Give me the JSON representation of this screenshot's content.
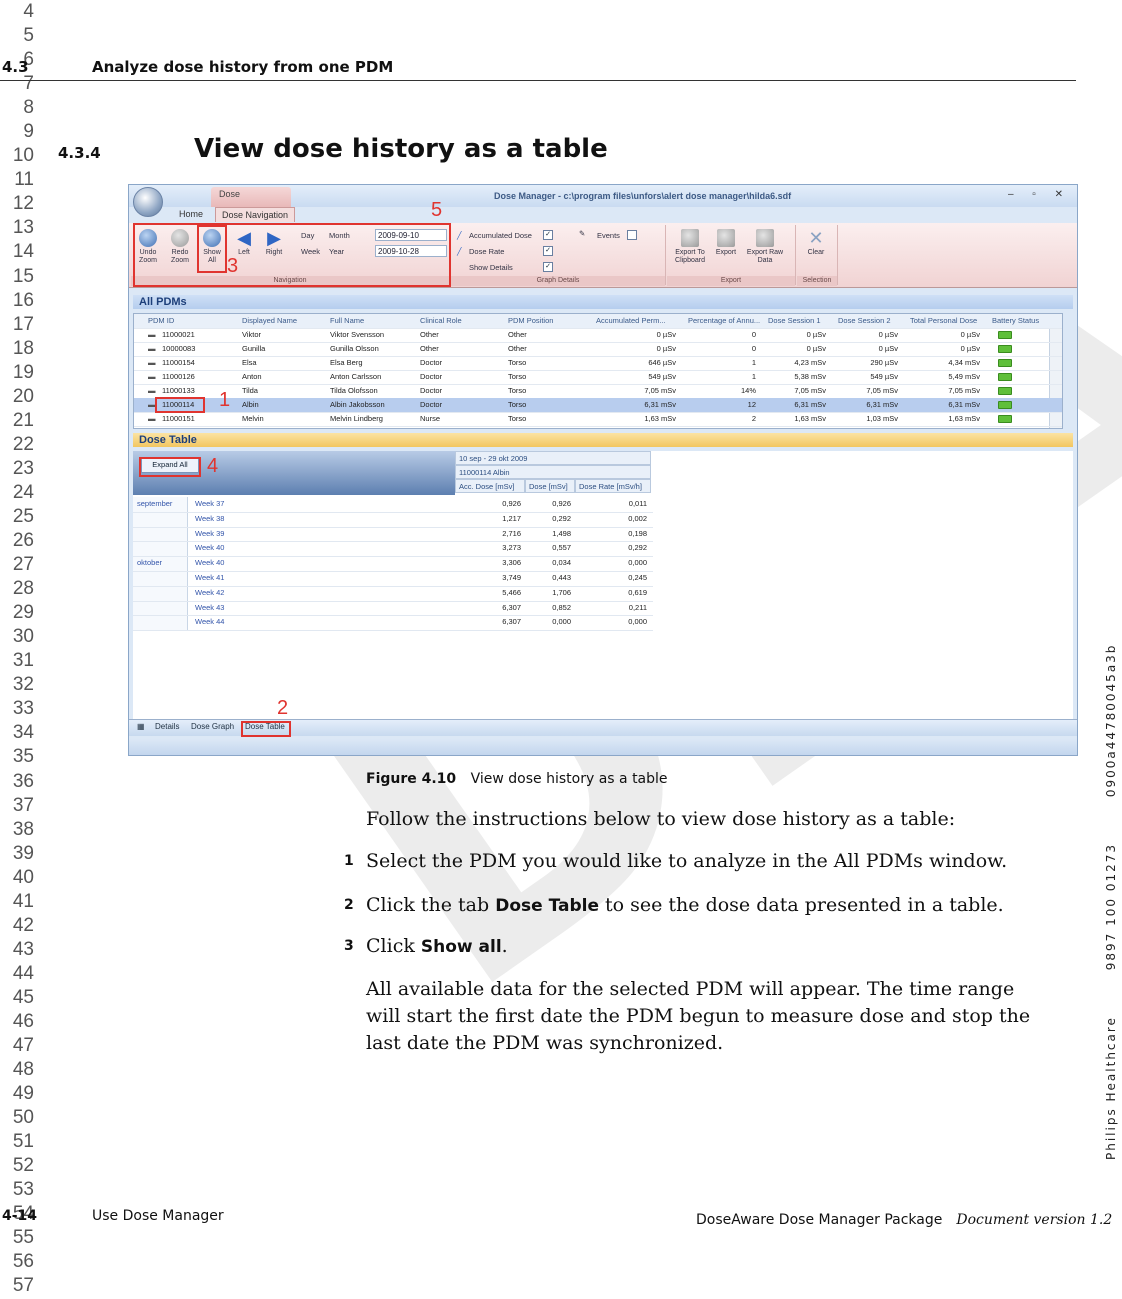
{
  "line_numbers": [
    "4",
    "5",
    "6",
    "7",
    "8",
    "9",
    "10",
    "11",
    "12",
    "13",
    "14",
    "15",
    "16",
    "17",
    "18",
    "19",
    "20",
    "21",
    "22",
    "23",
    "24",
    "25",
    "26",
    "27",
    "28",
    "29",
    "30",
    "31",
    "32",
    "33",
    "34",
    "35",
    "36",
    "37",
    "38",
    "39",
    "40",
    "41",
    "42",
    "43",
    "44",
    "45",
    "46",
    "47",
    "48",
    "49",
    "50",
    "51",
    "52",
    "53",
    "54",
    "55",
    "56",
    "57"
  ],
  "header": {
    "section": "4.3",
    "title": "Analyze dose history from one PDM"
  },
  "subsection": {
    "number": "4.3.4",
    "title": "View dose history as a table"
  },
  "watermark": "DRAFT",
  "side_text": {
    "company": "Philips Healthcare",
    "part_no": "9897 100 01273",
    "doc_id": "0900a44780045a3b"
  },
  "app": {
    "window_title": "Dose Manager - c:\\program files\\unfors\\alert dose manager\\hilda6.sdf",
    "context_tab": "Dose",
    "tabs": [
      "Home",
      "Dose Navigation"
    ],
    "ribbon": {
      "undo_zoom": "Undo Zoom",
      "redo_zoom": "Redo Zoom",
      "show_all": "Show All",
      "left": "Left",
      "right": "Right",
      "day": "Day",
      "month": "Month",
      "week": "Week",
      "year": "Year",
      "date_from": "2009-09-10",
      "date_to": "2009-10-28",
      "navigation_label": "Navigation",
      "accumulated_dose": "Accumulated Dose",
      "dose_rate": "Dose Rate",
      "show_details": "Show Details",
      "events": "Events",
      "graph_details_label": "Graph Details",
      "export_clipboard": "Export To Clipboard",
      "export": "Export",
      "export_raw": "Export Raw Data",
      "export_label": "Export",
      "clear": "Clear",
      "selection_label": "Selection"
    },
    "pdm_pane_title": "All PDMs",
    "pdm_columns": [
      "PDM ID",
      "Displayed Name",
      "Full Name",
      "Clinical Role",
      "PDM Position",
      "Accumulated Perm...",
      "Percentage of Annu...",
      "Dose Session 1",
      "Dose Session 2",
      "Total Personal Dose",
      "Battery Status"
    ],
    "pdm_rows": [
      [
        "11000021",
        "Viktor",
        "Viktor Svensson",
        "Other",
        "Other",
        "0 µSv",
        "0",
        "0 µSv",
        "0 µSv",
        "0 µSv"
      ],
      [
        "10000083",
        "Gunilla",
        "Gunilla Olsson",
        "Other",
        "Other",
        "0 µSv",
        "0",
        "0 µSv",
        "0 µSv",
        "0 µSv"
      ],
      [
        "11000154",
        "Elsa",
        "Elsa Berg",
        "Doctor",
        "Torso",
        "646 µSv",
        "1",
        "4,23 mSv",
        "290 µSv",
        "4,34 mSv"
      ],
      [
        "11000126",
        "Anton",
        "Anton Carlsson",
        "Doctor",
        "Torso",
        "549 µSv",
        "1",
        "5,38 mSv",
        "549 µSv",
        "5,49 mSv"
      ],
      [
        "11000133",
        "Tilda",
        "Tilda Olofsson",
        "Doctor",
        "Torso",
        "7,05 mSv",
        "14%",
        "7,05 mSv",
        "7,05 mSv",
        "7,05 mSv"
      ],
      [
        "11000114",
        "Albin",
        "Albin Jakobsson",
        "Doctor",
        "Torso",
        "6,31 mSv",
        "12",
        "6,31 mSv",
        "6,31 mSv",
        "6,31 mSv"
      ],
      [
        "11000151",
        "Melvin",
        "Melvin Lindberg",
        "Nurse",
        "Torso",
        "1,63 mSv",
        "2",
        "1,63 mSv",
        "1,03 mSv",
        "1,63 mSv"
      ]
    ],
    "dose_table_title": "Dose Table",
    "expand_all": "Expand All",
    "range_header": "10 sep - 29 okt 2009",
    "pdm_header": "11000114 Albin",
    "dose_columns": [
      "Acc. Dose [mSv]",
      "Dose [mSv]",
      "Dose Rate [mSv/h]"
    ],
    "dose_rows": [
      {
        "month": "september",
        "week": "Week 37",
        "acc": "0,926",
        "dose": "0,926",
        "rate": "0,011"
      },
      {
        "month": "",
        "week": "Week 38",
        "acc": "1,217",
        "dose": "0,292",
        "rate": "0,002"
      },
      {
        "month": "",
        "week": "Week 39",
        "acc": "2,716",
        "dose": "1,498",
        "rate": "0,198"
      },
      {
        "month": "",
        "week": "Week 40",
        "acc": "3,273",
        "dose": "0,557",
        "rate": "0,292"
      },
      {
        "month": "oktober",
        "week": "Week 40",
        "acc": "3,306",
        "dose": "0,034",
        "rate": "0,000"
      },
      {
        "month": "",
        "week": "Week 41",
        "acc": "3,749",
        "dose": "0,443",
        "rate": "0,245"
      },
      {
        "month": "",
        "week": "Week 42",
        "acc": "5,466",
        "dose": "1,706",
        "rate": "0,619"
      },
      {
        "month": "",
        "week": "Week 43",
        "acc": "6,307",
        "dose": "0,852",
        "rate": "0,211"
      },
      {
        "month": "",
        "week": "Week 44",
        "acc": "6,307",
        "dose": "0,000",
        "rate": "0,000"
      }
    ],
    "bottom_tabs": [
      "Details",
      "Dose Graph",
      "Dose Table"
    ],
    "callouts": [
      "1",
      "2",
      "3",
      "4",
      "5"
    ]
  },
  "figure": {
    "label": "Figure 4.10",
    "caption": "View dose history as a table"
  },
  "intro": "Follow the instructions below to view dose history as a table:",
  "steps": [
    {
      "num": "1",
      "pre": "Select the PDM you would like to analyze in the All PDMs window.",
      "kw": "",
      "post": ""
    },
    {
      "num": "2",
      "pre": "Click the tab ",
      "kw": "Dose Table",
      "post": " to see the dose data presented in a table."
    },
    {
      "num": "3",
      "pre": "Click ",
      "kw": "Show all",
      "post": "."
    }
  ],
  "result": "All available data for the selected PDM will appear. The time range will start the first date the PDM begun to measure dose and stop the last date the PDM was synchronized.",
  "footer": {
    "page": "4-14",
    "chapter": "Use Dose Manager",
    "product": "DoseAware Dose Manager Package",
    "version": "Document version 1.2"
  }
}
